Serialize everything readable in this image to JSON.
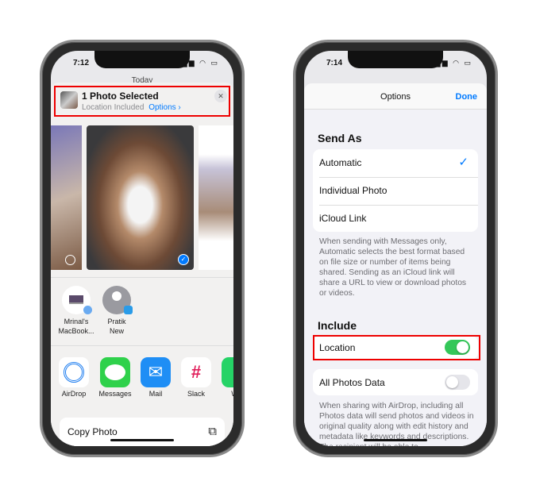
{
  "left_phone": {
    "time": "7:12",
    "background_title": "Today",
    "share_header": {
      "title": "1 Photo Selected",
      "subtitle": "Location Included",
      "options_link": "Options ›",
      "close": "✕"
    },
    "people": [
      {
        "name_line1": "Mrinal's",
        "name_line2": "MacBook..."
      },
      {
        "name_line1": "Pratik",
        "name_line2": "New"
      }
    ],
    "apps": [
      {
        "label": "AirDrop",
        "icon": "airdrop-icon",
        "color": "#ffffff"
      },
      {
        "label": "Messages",
        "icon": "messages-icon",
        "color": "#2fd14b"
      },
      {
        "label": "Mail",
        "icon": "mail-icon",
        "color": "#1f8ef5"
      },
      {
        "label": "Slack",
        "icon": "slack-icon",
        "color": "#ffffff"
      },
      {
        "label": "Wh",
        "icon": "whatsapp-icon",
        "color": "#25d366"
      }
    ],
    "action": {
      "label": "Copy Photo",
      "icon": "copy-icon"
    }
  },
  "right_phone": {
    "time": "7:14",
    "nav": {
      "title": "Options",
      "done": "Done"
    },
    "send_as": {
      "header": "Send As",
      "options": [
        "Automatic",
        "Individual Photo",
        "iCloud Link"
      ],
      "selected": "Automatic",
      "footer": "When sending with Messages only, Automatic selects the best format based on file size or number of items being shared. Sending as an iCloud link will share a URL to view or download photos or videos."
    },
    "include": {
      "header": "Include",
      "location": {
        "label": "Location",
        "on": true
      },
      "all_photos_data": {
        "label": "All Photos Data",
        "on": false
      },
      "footer": "When sharing with AirDrop, including all Photos data will send photos and videos in original quality along with edit history and metadata like keywords and descriptions. The recipient will be able to"
    }
  },
  "colors": {
    "accent": "#007aff",
    "toggle_on": "#34c759",
    "highlight": "#e00000"
  }
}
